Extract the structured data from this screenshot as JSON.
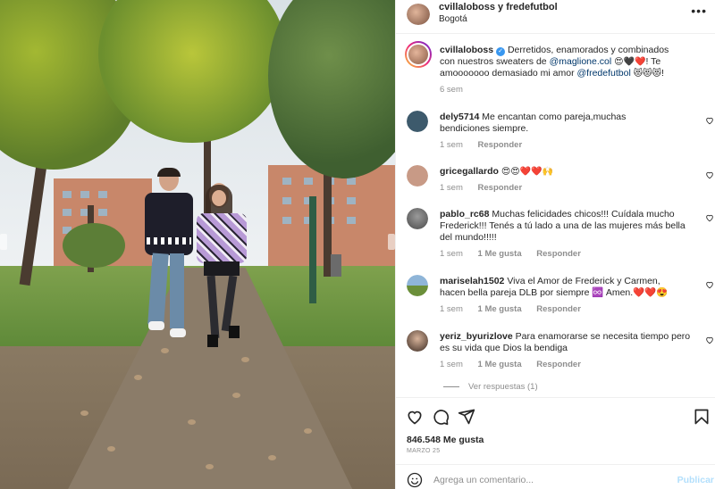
{
  "header": {
    "title": "cvillaloboss y fredefutbol",
    "location": "Bogotá",
    "more_icon": "ellipsis-icon"
  },
  "caption": {
    "user": "cvillaloboss",
    "text_1": "Derretidos, enamorados y combinados con nuestros sweaters de",
    "mention_1": "@maglione.col",
    "emoji_1": "😍🖤❤️",
    "text_2": "! Te amooooooo demasiado mi amor",
    "mention_2": "@fredefutbol",
    "emoji_2": "😻😻😻",
    "text_3": "!",
    "time": "6 sem"
  },
  "comments": [
    {
      "user": "dely5714",
      "text": "Me encantan como pareja,muchas bendiciones siempre.",
      "time": "1 sem",
      "likes": "",
      "reply": "Responder",
      "avatar_color": "#3d5a6c"
    },
    {
      "user": "gricegallardo",
      "text": "😍😍❤️❤️🙌",
      "time": "1 sem",
      "likes": "",
      "reply": "Responder",
      "avatar_color": "#c89a86"
    },
    {
      "user": "pablo_rc68",
      "text": "Muchas felicidades chicos!!! Cuídala mucho Frederick!!! Tenés a tú lado a una de las mujeres más bella del mundo!!!!!",
      "time": "1 sem",
      "likes": "1 Me gusta",
      "reply": "Responder",
      "avatar_color": "#6d6d6d"
    },
    {
      "user": "mariselah1502",
      "text": "Viva el Amor de Frederick y Carmen, hacen bella pareja DLB por siempre ♾️ Amen.❤️❤️😍",
      "time": "1 sem",
      "likes": "1 Me gusta",
      "reply": "Responder",
      "avatar_color": "#7aa0c4"
    },
    {
      "user": "yeriz_byurizlove",
      "text": "Para enamorarse se necesita tiempo pero es su vida que Dios la bendiga",
      "time": "1 sem",
      "likes": "1 Me gusta",
      "reply": "Responder",
      "avatar_color": "#5a4034"
    }
  ],
  "view_replies": "Ver respuestas (1)",
  "actions": {
    "like_icon": "heart-icon",
    "comment_icon": "comment-icon",
    "share_icon": "send-icon",
    "save_icon": "bookmark-icon"
  },
  "likes_count": "846.548 Me gusta",
  "date": "MARZO 25",
  "composer": {
    "placeholder": "Agrega un comentario...",
    "publish_label": "Publicar",
    "emoji_icon": "smiley-icon"
  },
  "colors": {
    "link": "#00376b",
    "muted": "#8e8e8e",
    "publish_disabled": "#b2dffc",
    "verified": "#3897f0"
  }
}
